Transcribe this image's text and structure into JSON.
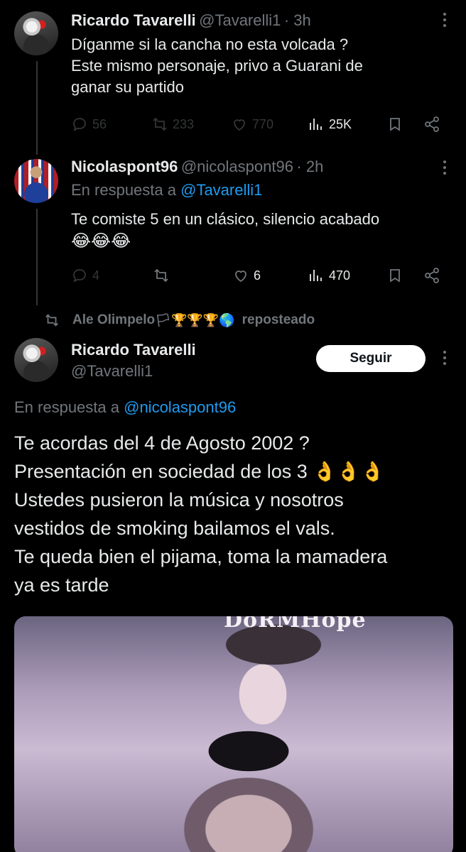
{
  "tweets": [
    {
      "name": "Ricardo Tavarelli",
      "handle": "@Tavarelli1",
      "time": "· 3h",
      "text_lines": [
        "Díganme si la cancha no esta volcada ?",
        "Este mismo personaje, privo a Guarani de",
        "ganar su partido"
      ],
      "replies": "56",
      "reposts": "233",
      "likes": "770",
      "views": "25K"
    },
    {
      "name": "Nicolaspont96",
      "handle": "@nicolaspont96",
      "time": "· 2h",
      "reply_prefix": "En respuesta a",
      "reply_to": "@Tavarelli1",
      "text_lines": [
        "Te comiste 5 en un clásico, silencio acabado",
        "😂😂😂"
      ],
      "replies": "4",
      "reposts": "",
      "likes": "6",
      "views": "470"
    }
  ],
  "repost_banner": {
    "user": "Ale Olimpelo",
    "badges": "🏳🏆🏆🏆🌎",
    "label": "reposteado"
  },
  "main_tweet": {
    "name": "Ricardo Tavarelli",
    "handle": "@Tavarelli1",
    "follow_label": "Seguir",
    "reply_prefix": "En respuesta a",
    "reply_to": "@nicolaspont96",
    "text_lines": [
      "Te acordas del 4 de Agosto 2002 ?",
      "Presentación en sociedad de los 3 👌👌👌",
      "Ustedes pusieron la música y nosotros",
      "vestidos de smoking bailamos el vals.",
      "Te queda bien el pijama, toma la mamadera",
      "ya es tarde"
    ],
    "media_caption": "DoRMHope"
  },
  "colors": {
    "background": "#000000",
    "text": "#e7e9ea",
    "secondary": "#71767b",
    "link": "#1d9bf0"
  }
}
